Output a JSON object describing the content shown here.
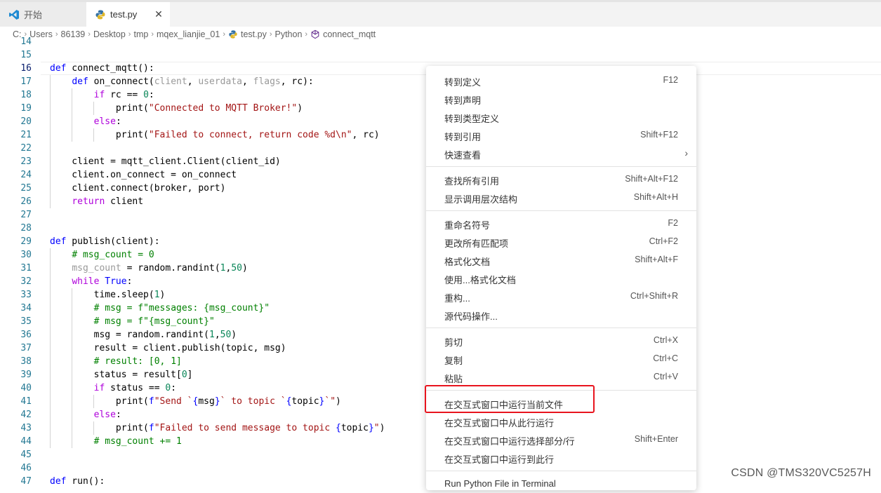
{
  "tabs": [
    {
      "label": "开始",
      "icon": "vscode-logo-icon"
    },
    {
      "label": "test.py",
      "icon": "python-file-icon",
      "close": "✕"
    }
  ],
  "breadcrumb": [
    "C:",
    "Users",
    "86139",
    "Desktop",
    "tmp",
    "mqex_lianjie_01",
    "test.py",
    "Python",
    "connect_mqtt"
  ],
  "code_lines": [
    {
      "n": "14",
      "html": ""
    },
    {
      "n": "15",
      "html": ""
    },
    {
      "n": "16",
      "html": "<span class='kw'>def</span> connect_mqtt():"
    },
    {
      "n": "17",
      "html": "    <span class='kw'>def</span> on_connect(<span class='dim'>client</span>, <span class='dim'>userdata</span>, <span class='dim'>flags</span>, rc):"
    },
    {
      "n": "18",
      "html": "        <span class='ctl'>if</span> rc == <span class='num'>0</span>:"
    },
    {
      "n": "19",
      "html": "            print(<span class='str'>\"Connected to MQTT Broker!\"</span>)"
    },
    {
      "n": "20",
      "html": "        <span class='ctl'>else</span>:"
    },
    {
      "n": "21",
      "html": "            print(<span class='str'>\"Failed to connect, return code %d\\n\"</span>, rc)"
    },
    {
      "n": "22",
      "html": ""
    },
    {
      "n": "23",
      "html": "    client = mqtt_client.Client(client_id)"
    },
    {
      "n": "24",
      "html": "    client.on_connect = on_connect"
    },
    {
      "n": "25",
      "html": "    client.connect(broker, port)"
    },
    {
      "n": "26",
      "html": "    <span class='ctl'>return</span> client"
    },
    {
      "n": "27",
      "html": ""
    },
    {
      "n": "28",
      "html": ""
    },
    {
      "n": "29",
      "html": "<span class='kw'>def</span> publish(client):"
    },
    {
      "n": "30",
      "html": "    <span class='cm'># msg_count = 0</span>"
    },
    {
      "n": "31",
      "html": "    <span class='dim'>msg_count</span> = random.randint(<span class='num'>1</span>,<span class='num'>50</span>)"
    },
    {
      "n": "32",
      "html": "    <span class='ctl'>while</span> <span class='kw'>True</span>:"
    },
    {
      "n": "33",
      "html": "        time.sleep(<span class='num'>1</span>)"
    },
    {
      "n": "34",
      "html": "        <span class='cm'># msg = f\"messages: {msg_count}\"</span>"
    },
    {
      "n": "35",
      "html": "        <span class='cm'># msg = f\"{msg_count}\"</span>"
    },
    {
      "n": "36",
      "html": "        msg = random.randint(<span class='num'>1</span>,<span class='num'>50</span>)"
    },
    {
      "n": "37",
      "html": "        result = client.publish(topic, msg)"
    },
    {
      "n": "38",
      "html": "        <span class='cm'># result: [0, 1]</span>"
    },
    {
      "n": "39",
      "html": "        status = result[<span class='num'>0</span>]"
    },
    {
      "n": "40",
      "html": "        <span class='ctl'>if</span> status == <span class='num'>0</span>:"
    },
    {
      "n": "41",
      "html": "            print(<span class='kw'>f</span><span class='str'>\"Send `</span><span class='kw'>{</span>msg<span class='kw'>}</span><span class='str'>` to topic `</span><span class='kw'>{</span>topic<span class='kw'>}</span><span class='str'>`\"</span>)"
    },
    {
      "n": "42",
      "html": "        <span class='ctl'>else</span>:"
    },
    {
      "n": "43",
      "html": "            print(<span class='kw'>f</span><span class='str'>\"Failed to send message to topic </span><span class='kw'>{</span>topic<span class='kw'>}</span><span class='str'>\"</span>)"
    },
    {
      "n": "44",
      "html": "        <span class='cm'># msg_count += 1</span>"
    },
    {
      "n": "45",
      "html": ""
    },
    {
      "n": "46",
      "html": ""
    },
    {
      "n": "47",
      "html": "<span class='kw'>def</span> run():"
    }
  ],
  "context_menu": {
    "groups": [
      [
        {
          "label": "转到定义",
          "key": "F12"
        },
        {
          "label": "转到声明",
          "key": ""
        },
        {
          "label": "转到类型定义",
          "key": ""
        },
        {
          "label": "转到引用",
          "key": "Shift+F12"
        },
        {
          "label": "快速查看",
          "key": "",
          "submenu": "›"
        }
      ],
      [
        {
          "label": "查找所有引用",
          "key": "Shift+Alt+F12"
        },
        {
          "label": "显示调用层次结构",
          "key": "Shift+Alt+H"
        }
      ],
      [
        {
          "label": "重命名符号",
          "key": "F2"
        },
        {
          "label": "更改所有匹配项",
          "key": "Ctrl+F2"
        },
        {
          "label": "格式化文档",
          "key": "Shift+Alt+F"
        },
        {
          "label": "使用...格式化文档",
          "key": ""
        },
        {
          "label": "重构...",
          "key": "Ctrl+Shift+R"
        },
        {
          "label": "源代码操作...",
          "key": ""
        }
      ],
      [
        {
          "label": "剪切",
          "key": "Ctrl+X"
        },
        {
          "label": "复制",
          "key": "Ctrl+C"
        },
        {
          "label": "粘贴",
          "key": "Ctrl+V"
        }
      ],
      [
        {
          "label": "在交互式窗口中运行当前文件",
          "key": ""
        },
        {
          "label": "在交互式窗口中从此行运行",
          "key": ""
        },
        {
          "label": "在交互式窗口中运行选择部分/行",
          "key": "Shift+Enter"
        },
        {
          "label": "在交互式窗口中运行到此行",
          "key": ""
        }
      ],
      [
        {
          "label": "Run Python File in Terminal",
          "key": ""
        }
      ]
    ]
  },
  "highlight_color": "#e8141e",
  "watermark": "CSDN @TMS320VC5257H"
}
